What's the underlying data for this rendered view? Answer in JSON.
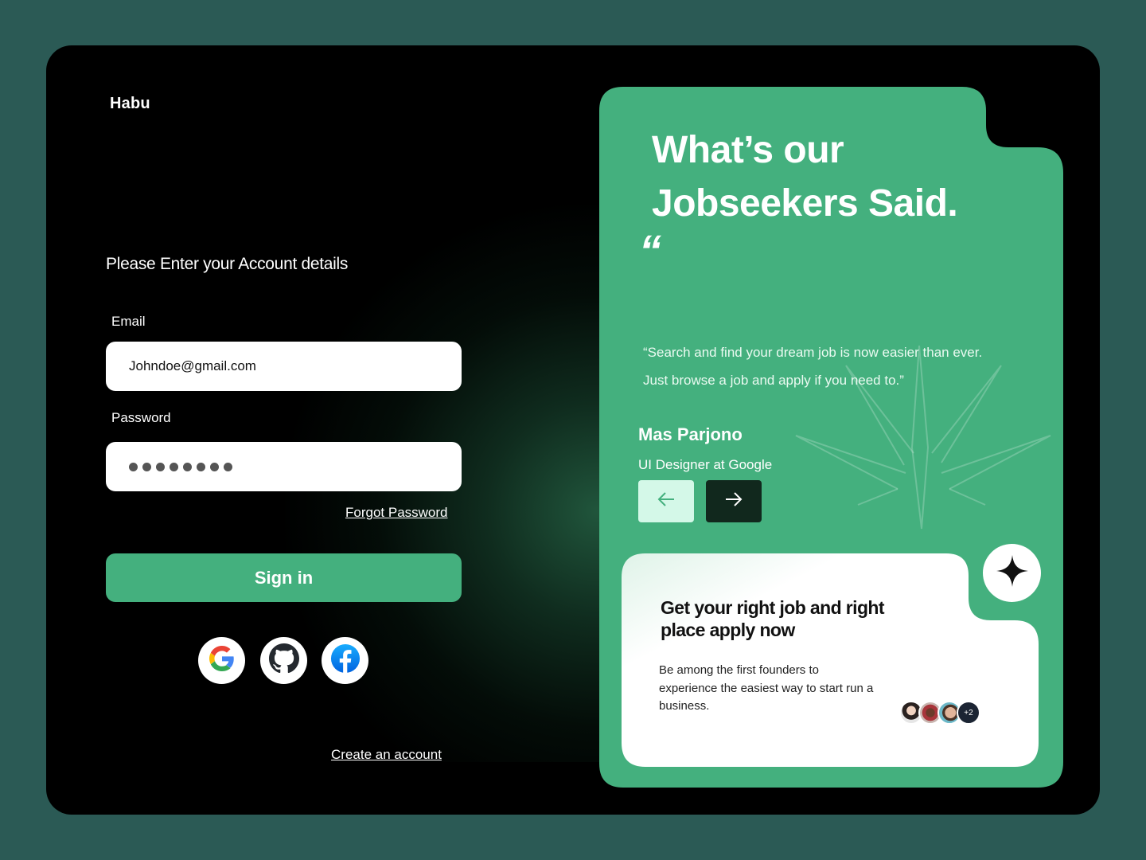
{
  "app": {
    "brand": "Habu"
  },
  "login": {
    "subtitle": "Please Enter your Account details",
    "email_label": "Email",
    "email_value": "Johndoe@gmail.com",
    "password_label": "Password",
    "password_masked_length": 8,
    "forgot_label": "Forgot Password",
    "signin_label": "Sign in",
    "social": [
      {
        "name": "Google",
        "icon": "google-icon"
      },
      {
        "name": "GitHub",
        "icon": "github-icon"
      },
      {
        "name": "Facebook",
        "icon": "facebook-icon"
      }
    ],
    "create_account_label": "Create an account"
  },
  "testimonial": {
    "headline_line1": "What’s our",
    "headline_line2": "Jobseekers Said.",
    "quote_mark": "“",
    "quote_line1": "“Search and find your dream job is now easier than ever.",
    "quote_line2": "Just browse a job and apply if you need to.”",
    "author": "Mas Parjono",
    "role": "UI Designer at Google",
    "prev_icon": "arrow-left-icon",
    "next_icon": "arrow-right-icon"
  },
  "promo": {
    "title": "Get your right job and right place apply now",
    "text": "Be among the first founders to experience the easiest way to start run a business.",
    "avatars_more": "+2",
    "sparkle_icon": "sparkle-icon"
  },
  "colors": {
    "background": "#2b5a55",
    "frame": "#000000",
    "accent": "#44b07e",
    "nav_prev_bg": "#d4f8e8",
    "nav_next_bg": "#11281d"
  }
}
